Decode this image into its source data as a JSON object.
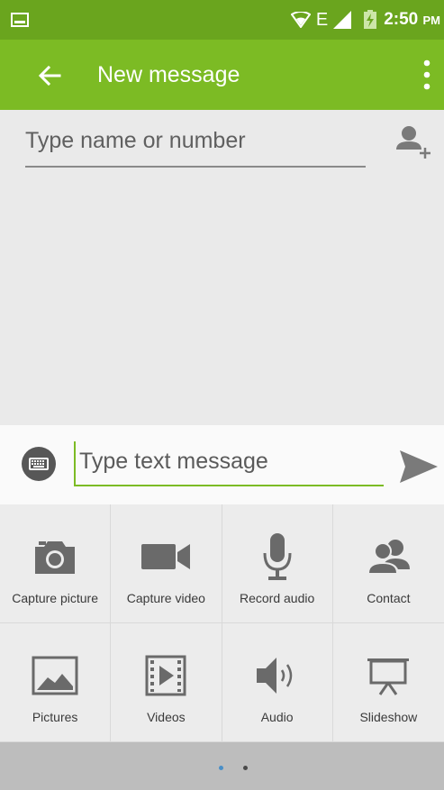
{
  "status_bar": {
    "network": "E",
    "time": "2:50",
    "ampm": "PM"
  },
  "app_bar": {
    "title": "New message"
  },
  "recipient": {
    "placeholder": "Type name or number"
  },
  "compose": {
    "placeholder": "Type text message"
  },
  "attachments": [
    {
      "label": "Capture picture",
      "icon": "camera-icon"
    },
    {
      "label": "Capture video",
      "icon": "video-camera-icon"
    },
    {
      "label": "Record audio",
      "icon": "microphone-icon"
    },
    {
      "label": "Contact",
      "icon": "contacts-icon"
    },
    {
      "label": "Pictures",
      "icon": "picture-icon"
    },
    {
      "label": "Videos",
      "icon": "video-file-icon"
    },
    {
      "label": "Audio",
      "icon": "speaker-icon"
    },
    {
      "label": "Slideshow",
      "icon": "slideshow-icon"
    }
  ],
  "pager": {
    "active_color": "#4a8fc7",
    "inactive_color": "#4a4a4a"
  },
  "colors": {
    "status_bar": "#6aa51e",
    "app_bar": "#7cbb24",
    "accent": "#7cbb24"
  }
}
